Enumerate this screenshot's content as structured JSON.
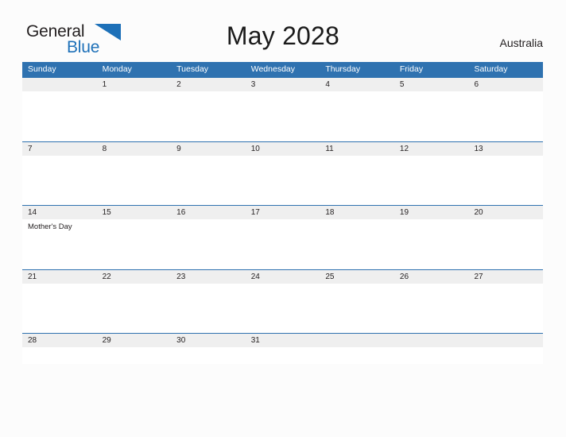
{
  "brand": {
    "word1": "General",
    "word2": "Blue",
    "flag_icon": "blue-triangle-flag-icon",
    "accent_color": "#1d70b8"
  },
  "header": {
    "title": "May 2028",
    "region": "Australia"
  },
  "theme": {
    "header_blue": "#2f72b0",
    "date_strip_gray": "#efefef",
    "page_background": "#fcfcfc",
    "text_color": "#231f20"
  },
  "calendar": {
    "weekdays": [
      "Sunday",
      "Monday",
      "Tuesday",
      "Wednesday",
      "Thursday",
      "Friday",
      "Saturday"
    ],
    "weeks": [
      {
        "days": [
          {
            "date": "",
            "events": []
          },
          {
            "date": "1",
            "events": []
          },
          {
            "date": "2",
            "events": []
          },
          {
            "date": "3",
            "events": []
          },
          {
            "date": "4",
            "events": []
          },
          {
            "date": "5",
            "events": []
          },
          {
            "date": "6",
            "events": []
          }
        ]
      },
      {
        "days": [
          {
            "date": "7",
            "events": []
          },
          {
            "date": "8",
            "events": []
          },
          {
            "date": "9",
            "events": []
          },
          {
            "date": "10",
            "events": []
          },
          {
            "date": "11",
            "events": []
          },
          {
            "date": "12",
            "events": []
          },
          {
            "date": "13",
            "events": []
          }
        ]
      },
      {
        "days": [
          {
            "date": "14",
            "events": [
              "Mother's Day"
            ]
          },
          {
            "date": "15",
            "events": []
          },
          {
            "date": "16",
            "events": []
          },
          {
            "date": "17",
            "events": []
          },
          {
            "date": "18",
            "events": []
          },
          {
            "date": "19",
            "events": []
          },
          {
            "date": "20",
            "events": []
          }
        ]
      },
      {
        "days": [
          {
            "date": "21",
            "events": []
          },
          {
            "date": "22",
            "events": []
          },
          {
            "date": "23",
            "events": []
          },
          {
            "date": "24",
            "events": []
          },
          {
            "date": "25",
            "events": []
          },
          {
            "date": "26",
            "events": []
          },
          {
            "date": "27",
            "events": []
          }
        ]
      },
      {
        "days": [
          {
            "date": "28",
            "events": []
          },
          {
            "date": "29",
            "events": []
          },
          {
            "date": "30",
            "events": []
          },
          {
            "date": "31",
            "events": []
          },
          {
            "date": "",
            "events": []
          },
          {
            "date": "",
            "events": []
          },
          {
            "date": "",
            "events": []
          }
        ]
      }
    ]
  }
}
